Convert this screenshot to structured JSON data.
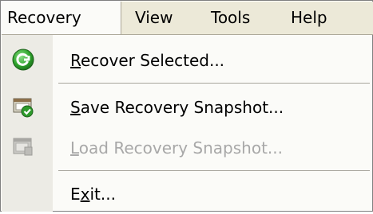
{
  "menubar": {
    "items": [
      {
        "label": "Recovery",
        "active": true
      },
      {
        "label": "View",
        "active": false
      },
      {
        "label": "Tools",
        "active": false
      },
      {
        "label": "Help",
        "active": false
      }
    ]
  },
  "menu": {
    "items": [
      {
        "pre": "",
        "mnemonic": "R",
        "post": "ecover Selected...",
        "enabled": true,
        "icon": "green-recover-icon"
      },
      {
        "pre": "",
        "mnemonic": "S",
        "post": "ave Recovery Snapshot...",
        "enabled": true,
        "icon": "save-snapshot-icon"
      },
      {
        "pre": "",
        "mnemonic": "L",
        "post": "oad Recovery Snapshot...",
        "enabled": false,
        "icon": "load-snapshot-icon"
      },
      {
        "pre": "E",
        "mnemonic": "x",
        "post": "it...",
        "enabled": true,
        "icon": ""
      }
    ]
  },
  "colors": {
    "menubar_bg": "#ece9d8",
    "menu_bg": "#fbfbf8",
    "icon_column_bg": "#ecebe5",
    "disabled_text": "#a8a8a8"
  }
}
